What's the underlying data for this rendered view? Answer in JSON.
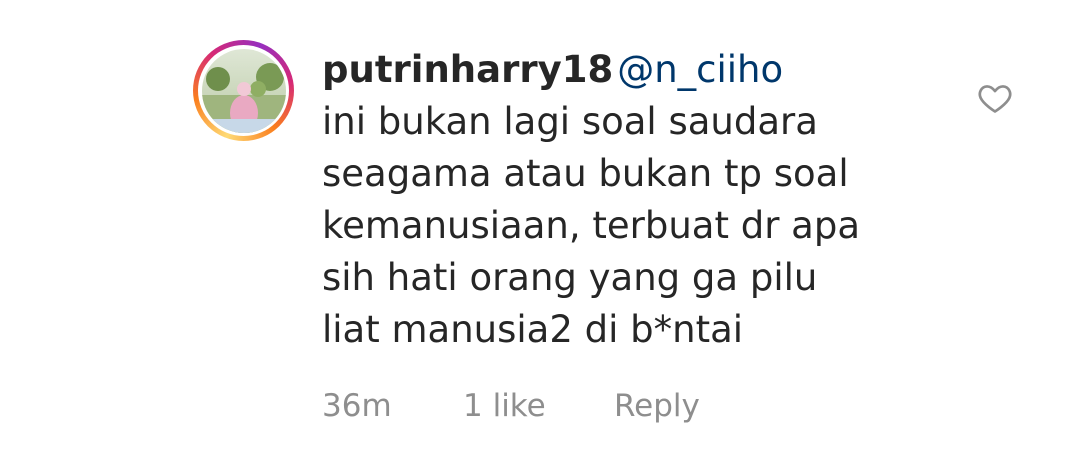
{
  "comment": {
    "username": "putrinharry18",
    "mention": "@n_ciiho",
    "text_lines": [
      "ini bukan lagi soal saudara",
      "seagama atau bukan tp soal",
      "kemanusiaan, terbuat dr apa",
      "sih hati orang yang ga pilu",
      "liat manusia2 di b*ntai"
    ],
    "time": "36m",
    "likes": "1 like",
    "reply_label": "Reply"
  },
  "icons": {
    "like": "heart-outline-icon",
    "avatar": "profile-photo"
  },
  "colors": {
    "text": "#262626",
    "mention": "#00376b",
    "meta": "#8e8e8e",
    "story_ring": [
      "#feda75",
      "#fa7e1e",
      "#d62976",
      "#962fbf"
    ]
  }
}
